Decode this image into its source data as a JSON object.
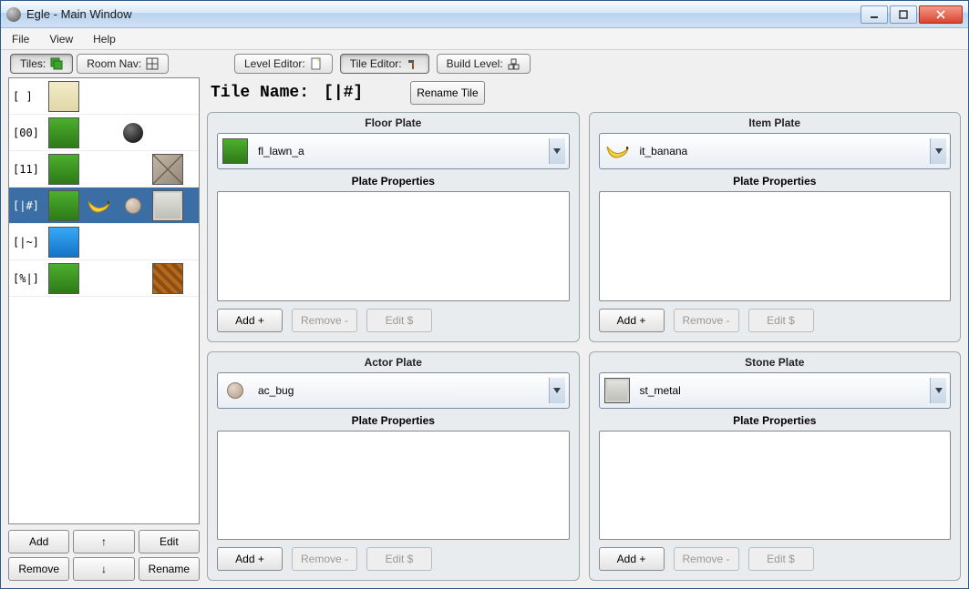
{
  "window": {
    "title": "Egle - Main Window"
  },
  "menu": {
    "file": "File",
    "view": "View",
    "help": "Help"
  },
  "left_tabs": {
    "tiles": "Tiles:",
    "roomnav": "Room Nav:"
  },
  "top_tabs": {
    "level": "Level Editor:",
    "tile": "Tile Editor:",
    "build": "Build Level:"
  },
  "tile_name": {
    "label": "Tile Name:",
    "value": "[|#]",
    "rename": "Rename Tile"
  },
  "sidebar": {
    "tiles": [
      {
        "code": "[  ]",
        "floor": "sand",
        "item": null,
        "actor": null,
        "stone": null
      },
      {
        "code": "[00]",
        "floor": "grass",
        "item": null,
        "actor": "ball",
        "stone": null
      },
      {
        "code": "[11]",
        "floor": "grass",
        "item": null,
        "actor": null,
        "stone": "stone"
      },
      {
        "code": "[|#]",
        "floor": "grass",
        "item": "banana",
        "actor": "bug",
        "stone": "metal"
      },
      {
        "code": "[|~]",
        "floor": "water",
        "item": null,
        "actor": null,
        "stone": null
      },
      {
        "code": "[%|]",
        "floor": "grass",
        "item": null,
        "actor": null,
        "stone": "wood"
      }
    ],
    "selected_index": 3,
    "buttons": {
      "add": "Add",
      "up": "↑",
      "edit": "Edit",
      "remove": "Remove",
      "down": "↓",
      "rename": "Rename"
    }
  },
  "plates": {
    "floor": {
      "title": "Floor Plate",
      "value": "fl_lawn_a",
      "icon": "grass",
      "props_label": "Plate Properties",
      "add": "Add +",
      "remove": "Remove -",
      "edit": "Edit $"
    },
    "item": {
      "title": "Item Plate",
      "value": "it_banana",
      "icon": "banana",
      "props_label": "Plate Properties",
      "add": "Add +",
      "remove": "Remove -",
      "edit": "Edit $"
    },
    "actor": {
      "title": "Actor Plate",
      "value": "ac_bug",
      "icon": "bug",
      "props_label": "Plate Properties",
      "add": "Add +",
      "remove": "Remove -",
      "edit": "Edit $"
    },
    "stone": {
      "title": "Stone Plate",
      "value": "st_metal",
      "icon": "metal",
      "props_label": "Plate Properties",
      "add": "Add +",
      "remove": "Remove -",
      "edit": "Edit $"
    }
  }
}
